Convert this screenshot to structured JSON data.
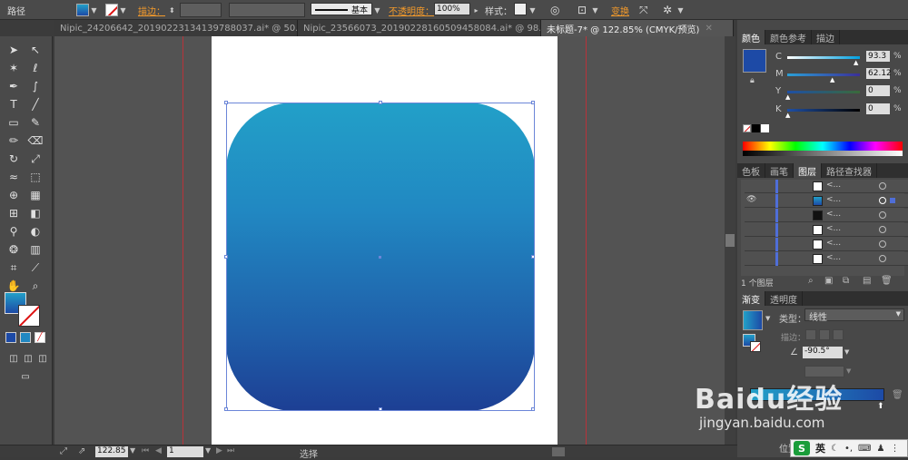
{
  "control_bar": {
    "path_label": "路径",
    "stroke_label": "描边：",
    "line_profile": "基本",
    "opacity_label": "不透明度：",
    "opacity_value": "100%",
    "style_label": "样式：",
    "transform_label": "变换"
  },
  "doc_tabs": [
    {
      "label": "Nipic_24206642_20190223134139788037.ai* @ 50..."
    },
    {
      "label": "Nipic_23566073_20190228160509458084.ai* @ 98..."
    },
    {
      "label": "未标题-7* @ 122.85% (CMYK/预览)"
    }
  ],
  "color_panel": {
    "tabs": [
      "颜色",
      "颜色参考",
      "描边"
    ],
    "channels": [
      {
        "name": "C",
        "value": "93.3",
        "unit": "%"
      },
      {
        "name": "M",
        "value": "62.12",
        "unit": "%"
      },
      {
        "name": "Y",
        "value": "0",
        "unit": "%"
      },
      {
        "name": "K",
        "value": "0",
        "unit": "%"
      }
    ],
    "swatch_color": "#1d4aa6"
  },
  "layers_panel": {
    "tabs": [
      "色板",
      "画笔",
      "图层",
      "路径查找器"
    ],
    "rows": [
      {
        "name": "<..."
      },
      {
        "name": "<..."
      },
      {
        "name": "<..."
      },
      {
        "name": "<..."
      },
      {
        "name": "<..."
      },
      {
        "name": "<..."
      }
    ],
    "footer": "1 个图层"
  },
  "gradient_panel": {
    "tabs": [
      "渐变",
      "透明度"
    ],
    "type_label": "类型：",
    "type_value": "线性",
    "stroke_label": "描边：",
    "angle_value": "-90.5°",
    "position_label": "位置"
  },
  "status_bar": {
    "zoom": "122.85",
    "page": "1",
    "tool": "选择"
  },
  "watermark": {
    "brand": "Baidu经验",
    "url": "jingyan.baidu.com"
  },
  "taskbar": {
    "ime_label": "英"
  }
}
